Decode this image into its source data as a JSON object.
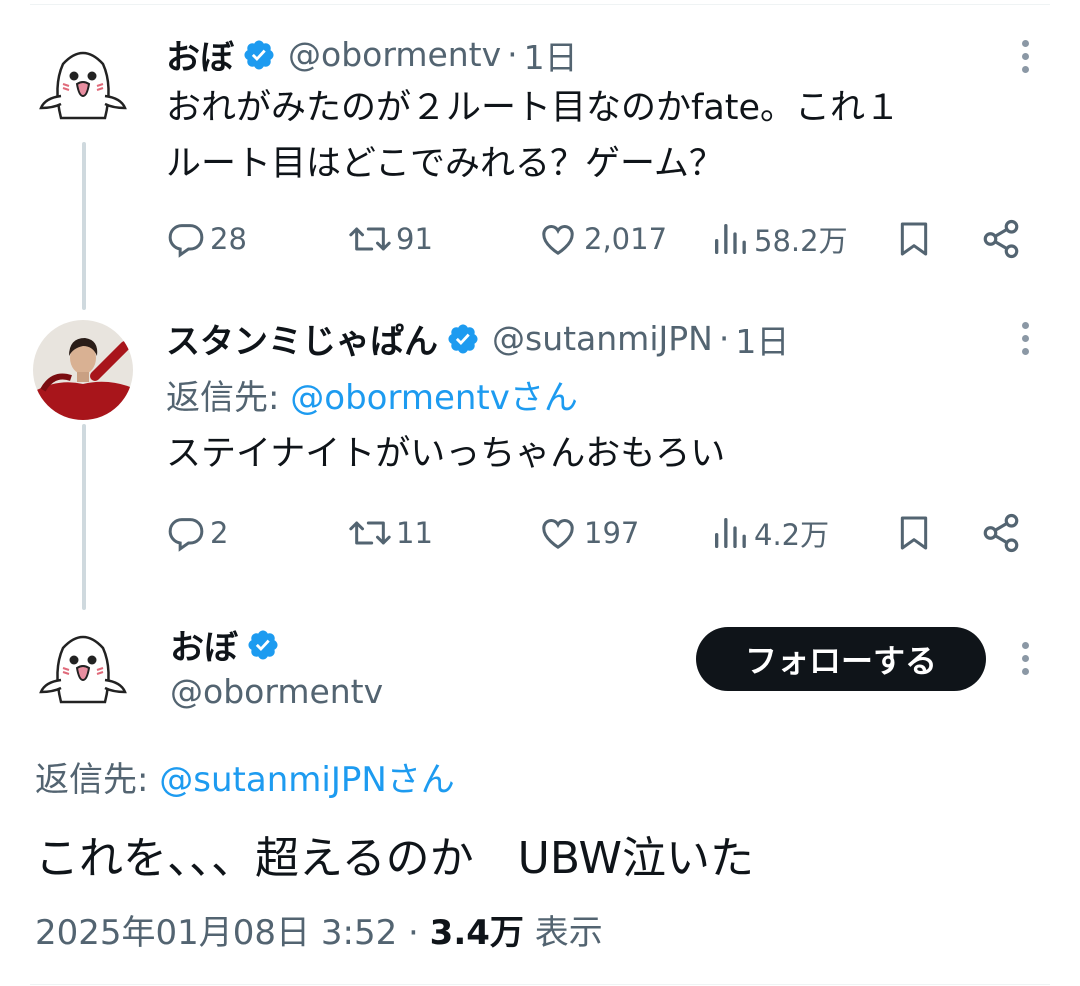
{
  "tweets": [
    {
      "name": "おぼ",
      "handle": "@obormentv",
      "sep": "·",
      "time": "1日",
      "text_lines": [
        "おれがみたのが２ルート目なのかfate。これ１",
        "ルート目はどこでみれる？ゲーム？"
      ],
      "replies": "28",
      "retweets": "91",
      "likes": "2,017",
      "views": "58.2万"
    },
    {
      "name": "スタンミじゃぱん",
      "handle": "@sutanmiJPN",
      "sep": "·",
      "time": "1日",
      "reply_to_prefix": "返信先:",
      "reply_to_mention": "@obormentvさん",
      "text_lines": [
        "ステイナイトがいっちゃんおもろい"
      ],
      "replies": "2",
      "retweets": "11",
      "likes": "197",
      "views": "4.2万"
    }
  ],
  "main_tweet": {
    "name": "おぼ",
    "handle": "@obormentv",
    "follow_label": "フォローする",
    "reply_to_prefix": "返信先:",
    "reply_to_mention": "@sutanmiJPNさん",
    "text": "これを、、、超えるのか　UBW泣いた",
    "timestamp": "2025年01月08日 3:52",
    "sep": "·",
    "views_count": "3.4万",
    "views_label": "表示"
  },
  "colors": {
    "verified": "#1d9bf0",
    "mention": "#1d9bf0",
    "secondary": "#536471",
    "follow_bg": "#0f1419"
  },
  "icons": [
    "reply-icon",
    "retweet-icon",
    "like-icon",
    "views-icon",
    "bookmark-icon",
    "share-icon",
    "more-icon",
    "verified-icon"
  ]
}
